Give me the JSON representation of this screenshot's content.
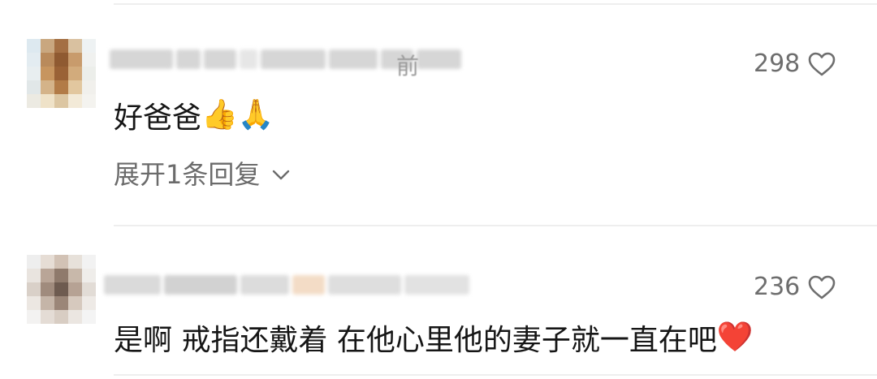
{
  "comments": [
    {
      "text": "好爸爸",
      "emojis": [
        "👍",
        "🙏"
      ],
      "likes": "298",
      "time_fragment": "前",
      "reply_toggle": "展开1条回复"
    },
    {
      "text": "是啊 戒指还戴着 在他心里他的妻子就一直在吧",
      "emojis": [
        "❤️"
      ],
      "likes": "236"
    }
  ],
  "icons": {
    "like": "heart-outline-icon",
    "expand": "chevron-down-icon"
  },
  "colors": {
    "text": "#161616",
    "secondary": "#6e6e6e",
    "divider": "#eeeeee"
  }
}
